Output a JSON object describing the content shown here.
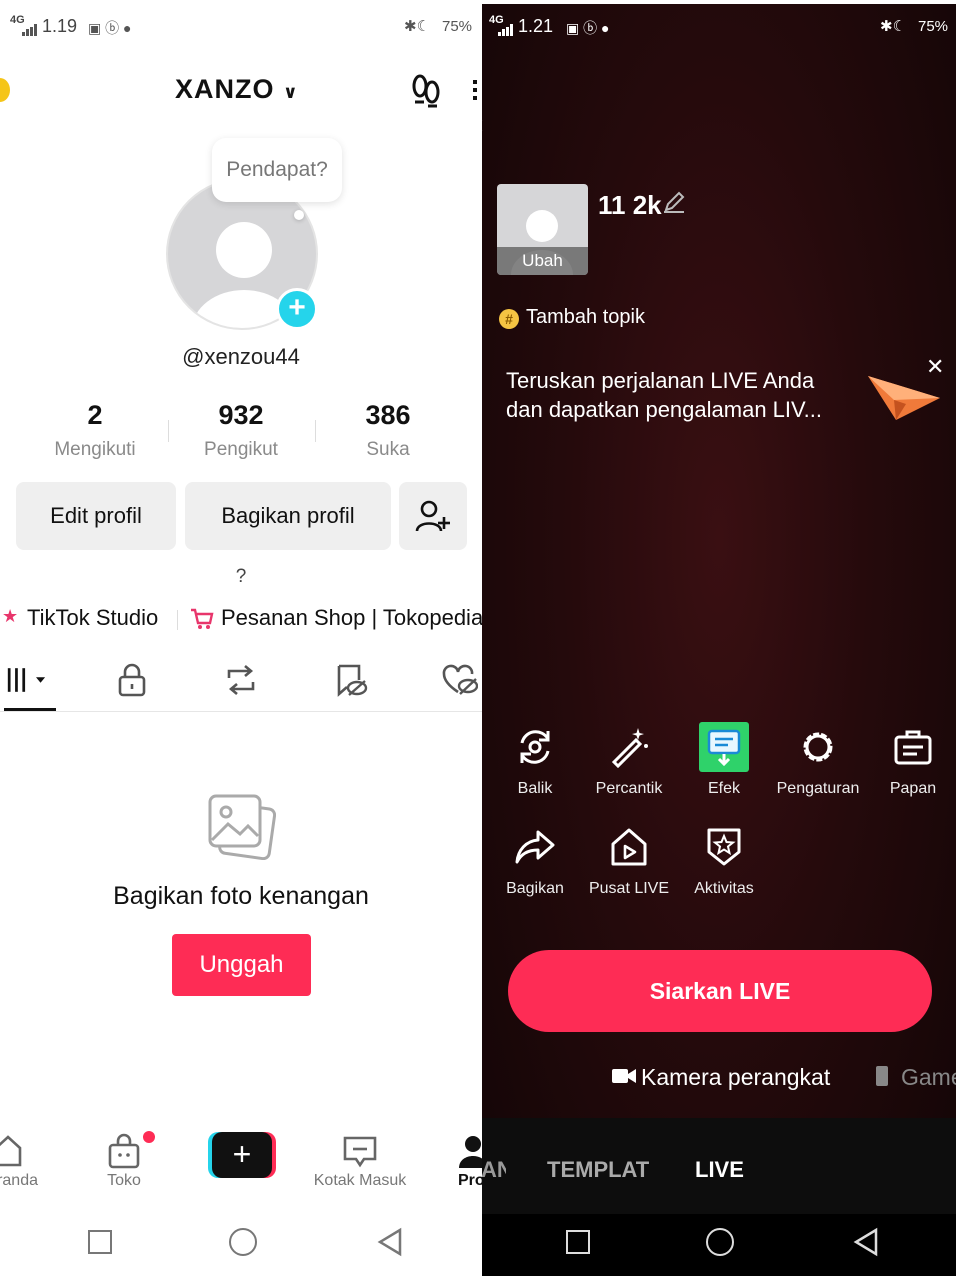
{
  "left": {
    "status": {
      "net": "4G",
      "time": "1.19",
      "battery": "75%"
    },
    "header": {
      "username": "XANZO"
    },
    "bubble": "Pendapat?",
    "handle": "@xenzou44",
    "stats": [
      {
        "n": "2",
        "l": "Mengikuti"
      },
      {
        "n": "932",
        "l": "Pengikut"
      },
      {
        "n": "386",
        "l": "Suka"
      }
    ],
    "buttons": {
      "edit": "Edit profil",
      "share": "Bagikan profil"
    },
    "bio": "?",
    "links": {
      "studio": "TikTok Studio",
      "shop": "Pesanan Shop | Tokopedia"
    },
    "empty": {
      "title": "Bagikan foto kenangan",
      "upload": "Unggah"
    },
    "nav": {
      "home": "Beranda",
      "shop": "Toko",
      "inbox": "Kotak Masuk",
      "profile": "Profil"
    }
  },
  "right": {
    "status": {
      "net": "4G",
      "time": "1.21",
      "battery": "75%"
    },
    "cover": {
      "change": "Ubah"
    },
    "title": "11 2k",
    "topic": "Tambah topik",
    "banner": {
      "line1": "Teruskan perjalanan LIVE Anda",
      "line2": "dan dapatkan pengalaman LIV..."
    },
    "tools": [
      {
        "label": "Balik",
        "icon": "flip-camera-icon"
      },
      {
        "label": "Percantik",
        "icon": "beauty-wand-icon"
      },
      {
        "label": "Efek",
        "icon": "effects-icon"
      },
      {
        "label": "Pengaturan",
        "icon": "settings-gear-icon"
      },
      {
        "label": "Papan",
        "icon": "board-icon"
      },
      {
        "label": "Bagikan",
        "icon": "share-arrow-icon"
      },
      {
        "label": "Pusat LIVE",
        "icon": "live-center-icon"
      },
      {
        "label": "Aktivitas",
        "icon": "activity-badge-icon"
      }
    ],
    "go_live": "Siarkan LIVE",
    "sources": {
      "camera": "Kamera perangkat",
      "game": "Game"
    },
    "modes": {
      "prev": "POSTINGAN",
      "template": "TEMPLAT",
      "live": "LIVE"
    }
  },
  "colors": {
    "accent": "#fe2c55",
    "cyan": "#25d4eb",
    "efek": "#2fd26a"
  }
}
